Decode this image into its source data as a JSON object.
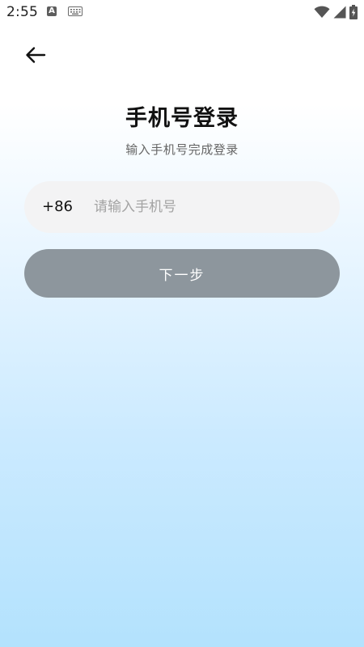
{
  "status_bar": {
    "time": "2:55",
    "notification_icons": [
      "a-app-icon",
      "keyboard-icon"
    ],
    "system_icons": [
      "wifi-icon",
      "cell-signal-icon",
      "battery-charging-icon"
    ],
    "notif_a_letter": "A"
  },
  "header": {
    "back_icon": "arrow-left-icon"
  },
  "main": {
    "title": "手机号登录",
    "subtitle": "输入手机号完成登录",
    "phone": {
      "country_code": "+86",
      "value": "",
      "placeholder": "请输入手机号"
    },
    "next_button_label": "下一步"
  },
  "colors": {
    "field_bg": "#f3f3f4",
    "button_bg": "#8d969d",
    "button_text": "#ffffff",
    "placeholder": "#a3a3a3",
    "gradient_bottom": "#b3e2fd"
  }
}
